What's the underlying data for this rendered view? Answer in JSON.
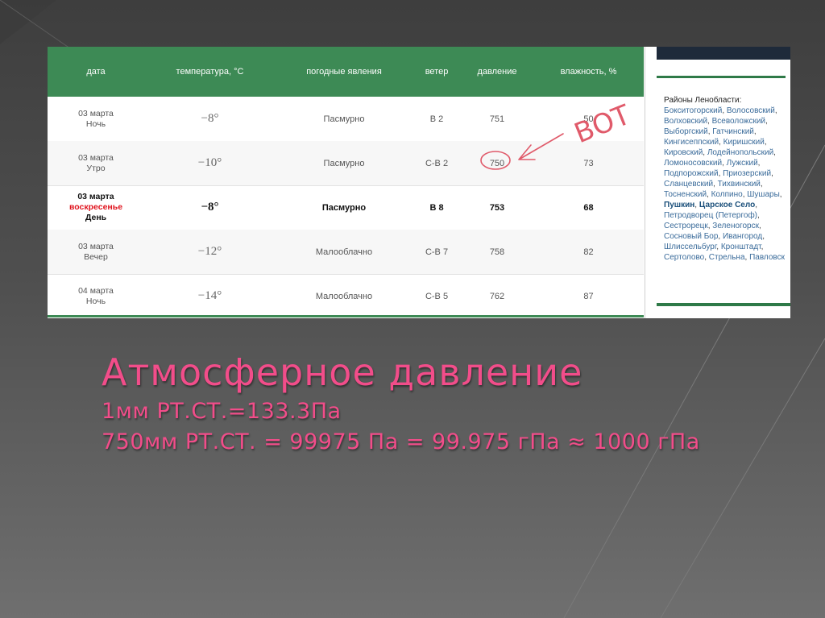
{
  "table": {
    "headers": {
      "date": "дата",
      "temp": "температура, °C",
      "weather": "погодные явления",
      "wind": "ветер",
      "pressure": "давление",
      "humidity": "влажность, %"
    },
    "rows": [
      {
        "date": "03 марта",
        "day": "",
        "period": "Ночь",
        "temp": "−8°",
        "weather": "Пасмурно",
        "wind": "В 2",
        "pressure": "751",
        "humidity": "50"
      },
      {
        "date": "03 марта",
        "day": "",
        "period": "Утро",
        "temp": "−10°",
        "weather": "Пасмурно",
        "wind": "С-В 2",
        "pressure": "750",
        "humidity": "73"
      },
      {
        "date": "03 марта",
        "day": "воскресенье",
        "period": "День",
        "temp": "−8°",
        "weather": "Пасмурно",
        "wind": "В 8",
        "pressure": "753",
        "humidity": "68"
      },
      {
        "date": "03 марта",
        "day": "",
        "period": "Вечер",
        "temp": "−12°",
        "weather": "Малооблачно",
        "wind": "С-В 7",
        "pressure": "758",
        "humidity": "82"
      },
      {
        "date": "04 марта",
        "day": "",
        "period": "Ночь",
        "temp": "−14°",
        "weather": "Малооблачно",
        "wind": "С-В 5",
        "pressure": "762",
        "humidity": "87"
      }
    ]
  },
  "sidebar": {
    "heading": "Районы Ленобласти:",
    "regions": [
      "Бокситогорский",
      "Волосовский",
      "Волховский",
      "Всеволожский",
      "Выборгский",
      "Гатчинский",
      "Кингисеппский",
      "Киришский",
      "Кировский",
      "Лодейнопольский",
      "Ломоносовский",
      "Лужский",
      "Подпорожский",
      "Приозерский",
      "Сланцевский",
      "Тихвинский",
      "Тосненский",
      "Колпино",
      "Шушары",
      "Пушкин",
      "Царское Село",
      "Петродворец (Петергоф)",
      "Сестрорецк",
      "Зеленогорск",
      "Сосновый Бор",
      "Ивангород",
      "Шлиссельбург",
      "Кронштадт",
      "Сертолово",
      "Стрельна",
      "Павловск"
    ],
    "bold_regions": [
      "Пушкин",
      "Царское Село"
    ]
  },
  "annotation": {
    "text": "ВОТ"
  },
  "caption": {
    "title": "Атмосферное давление",
    "line1": "1мм РТ.СТ.=133.3Па",
    "line2": "750мм РТ.СТ. = 99975 Па = 99.975 гПа ≈ 1000 гПа"
  },
  "colors": {
    "header_green": "#3d8a55",
    "caption_pink": "#f24d8a",
    "highlight_red": "#e0141e",
    "annotation_red": "#e05a6a"
  }
}
